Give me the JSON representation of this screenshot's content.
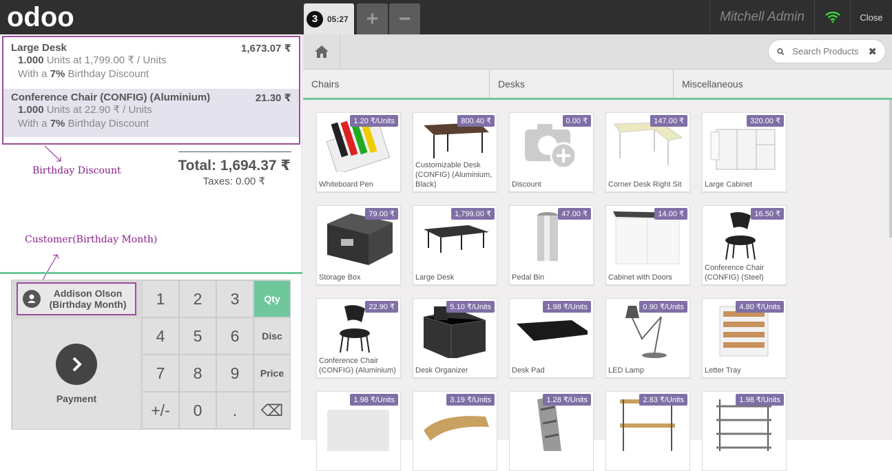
{
  "topbar": {
    "logo_text": "odoo",
    "order_number": "3",
    "order_time": "05:27",
    "add_label": "+",
    "remove_label": "−",
    "user": "Mitchell Admin",
    "close_label": "Close"
  },
  "order": {
    "lines": [
      {
        "name": "Large Desk",
        "price": "1,673.07 ₹",
        "qty": "1.000",
        "unit_text": "Units at 1,799.00 ₹ / Units",
        "discount_pre": "With a ",
        "discount_pct": "7%",
        "discount_post": " Birthday Discount"
      },
      {
        "name": "Conference Chair (CONFIG) (Aluminium)",
        "price": "21.30 ₹",
        "qty": "1.000",
        "unit_text": "Units at 22.90 ₹ / Units",
        "discount_pre": "With a ",
        "discount_pct": "7%",
        "discount_post": " Birthday Discount"
      }
    ],
    "total": "Total: 1,694.37 ₹",
    "taxes": "Taxes: 0.00 ₹"
  },
  "annotations": {
    "birthday_discount": "Birthday  Discount",
    "customer_note": "Customer(Birthday  Month)"
  },
  "customer": {
    "name": "Addison Olson",
    "sub": "(Birthday Month)"
  },
  "payment_label": "Payment",
  "keypad": [
    "1",
    "2",
    "3",
    "Qty",
    "4",
    "5",
    "6",
    "Disc",
    "7",
    "8",
    "9",
    "Price",
    "+/-",
    "0",
    ".",
    "⌫"
  ],
  "search": {
    "placeholder": "Search Products",
    "clear": "✖"
  },
  "categories": [
    "Chairs",
    "Desks",
    "Miscellaneous"
  ],
  "products": [
    {
      "name": "Whiteboard Pen",
      "price": "1.20 ₹/Units"
    },
    {
      "name": "Customizable Desk (CONFIG) (Aluminium, Black)",
      "price": "800.40 ₹"
    },
    {
      "name": "Discount",
      "price": "0.00 ₹"
    },
    {
      "name": "Corner Desk Right Sit",
      "price": "147.00 ₹"
    },
    {
      "name": "Large Cabinet",
      "price": "320.00 ₹"
    },
    {
      "name": "Storage Box",
      "price": "79.00 ₹"
    },
    {
      "name": "Large Desk",
      "price": "1,799.00 ₹"
    },
    {
      "name": "Pedal Bin",
      "price": "47.00 ₹"
    },
    {
      "name": "Cabinet with Doors",
      "price": "14.00 ₹"
    },
    {
      "name": "Conference Chair (CONFIG) (Steel)",
      "price": "16.50 ₹"
    },
    {
      "name": "Conference Chair (CONFIG) (Aluminium)",
      "price": "22.90 ₹"
    },
    {
      "name": "Desk Organizer",
      "price": "5.10 ₹/Units"
    },
    {
      "name": "Desk Pad",
      "price": "1.98 ₹/Units"
    },
    {
      "name": "LED Lamp",
      "price": "0.90 ₹/Units"
    },
    {
      "name": "Letter Tray",
      "price": "4.80 ₹/Units"
    },
    {
      "name": "",
      "price": "1.98 ₹/Units"
    },
    {
      "name": "",
      "price": "3.19 ₹/Units"
    },
    {
      "name": "",
      "price": "1.28 ₹/Units"
    },
    {
      "name": "",
      "price": "2.83 ₹/Units"
    },
    {
      "name": "",
      "price": "1.98 ₹/Units"
    }
  ],
  "colors": {
    "accent": "#6ec89b",
    "badge": "#7f6fa6",
    "annotation": "#8a1f8a",
    "topbar": "#2f2f2f"
  }
}
